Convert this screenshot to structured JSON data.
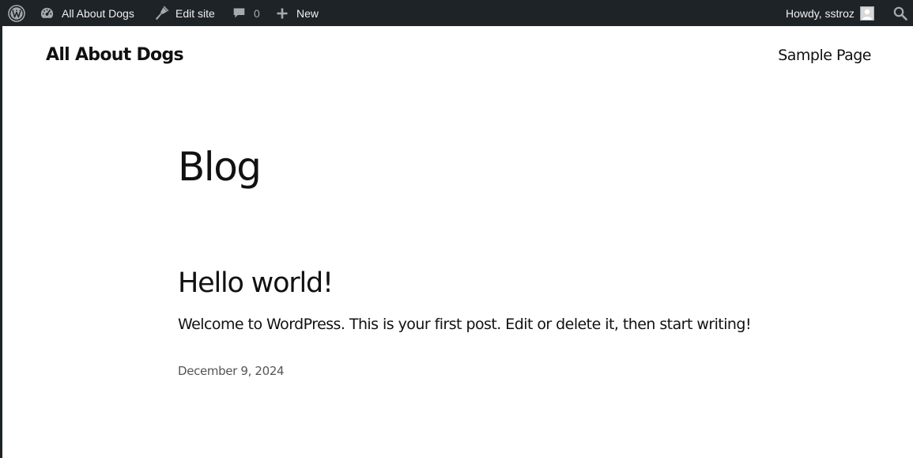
{
  "admin_bar": {
    "wp_logo_icon": "wordpress-logo-icon",
    "site_name": "All About Dogs",
    "site_icon": "dashboard-gauge-icon",
    "edit_site": "Edit site",
    "edit_icon": "brush-icon",
    "comments_icon": "comment-bubble-icon",
    "comments_count": "0",
    "new_icon": "plus-icon",
    "new_label": "New",
    "greeting": "Howdy, sstroz",
    "avatar_icon": "user-avatar-icon",
    "search_icon": "search-icon",
    "background_color": "#1d2327",
    "text_color": "#f0f0f1"
  },
  "site": {
    "title": "All About Dogs",
    "nav": {
      "items": [
        {
          "label": "Sample Page"
        }
      ]
    },
    "background_color": "#ffffff"
  },
  "main": {
    "heading": "Blog",
    "posts": [
      {
        "title": "Hello world!",
        "excerpt": "Welcome to WordPress. This is your first post. Edit or delete it, then start writing!",
        "date": "December 9, 2024"
      }
    ]
  }
}
